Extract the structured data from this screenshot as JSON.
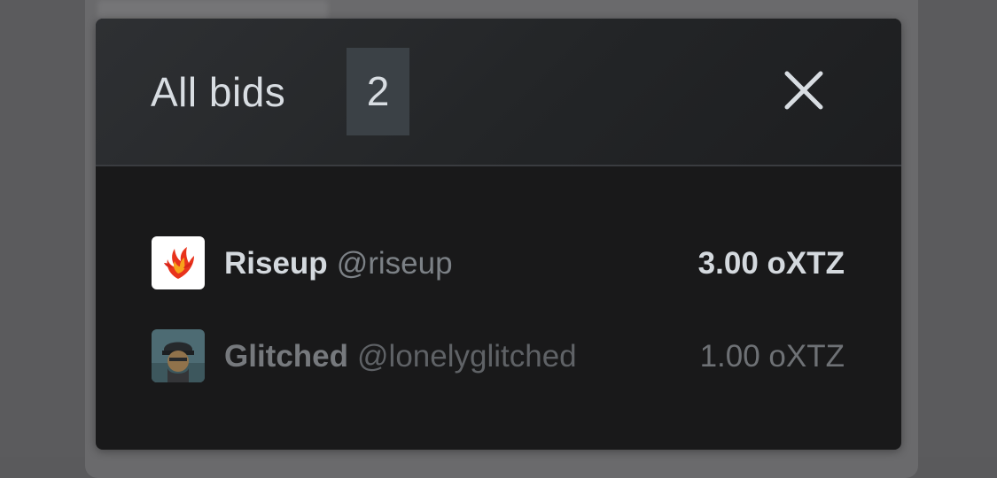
{
  "modal": {
    "title": "All bids",
    "count": "2",
    "close_icon": "close-icon"
  },
  "bids": [
    {
      "name": "Riseup",
      "handle": "@riseup",
      "amount": "3.00 oXTZ",
      "avatar_icon": "phoenix-avatar-icon",
      "highlight": true
    },
    {
      "name": "Glitched",
      "handle": "@lonelyglitched",
      "amount": "1.00 oXTZ",
      "avatar_icon": "character-avatar-icon",
      "highlight": false
    }
  ],
  "colors": {
    "modal_background": "#19191a",
    "header_background": "#2a2c2f",
    "badge_background": "#3b4146",
    "primary_text": "#d4d9de",
    "muted_text": "#6e7175",
    "backdrop": "#5b5b5d"
  }
}
